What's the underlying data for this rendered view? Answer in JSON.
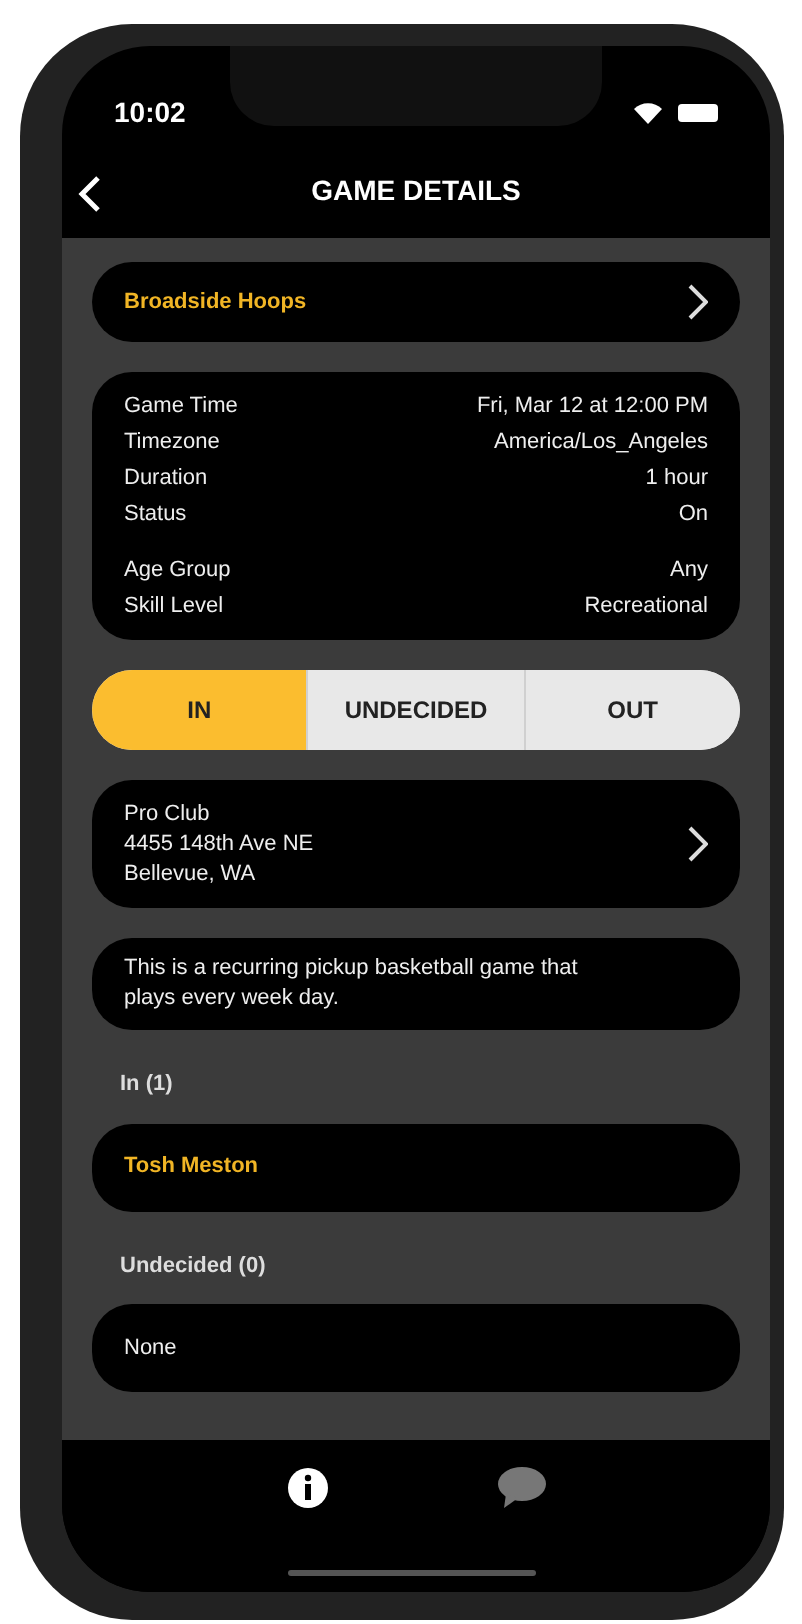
{
  "status_bar": {
    "time": "10:02"
  },
  "nav": {
    "title": "GAME DETAILS"
  },
  "group": {
    "name": "Broadside Hoops"
  },
  "detail_groups": [
    [
      {
        "label": "Game Time",
        "value": "Fri, Mar 12 at 12:00 PM"
      },
      {
        "label": "Timezone",
        "value": "America/Los_Angeles"
      },
      {
        "label": "Duration",
        "value": "1 hour"
      },
      {
        "label": "Status",
        "value": "On"
      }
    ],
    [
      {
        "label": "Age Group",
        "value": "Any"
      },
      {
        "label": "Skill Level",
        "value": "Recreational"
      }
    ]
  ],
  "rsvp_tabs": [
    {
      "label": "IN",
      "selected": true
    },
    {
      "label": "UNDECIDED",
      "selected": false
    },
    {
      "label": "OUT",
      "selected": false
    }
  ],
  "location": {
    "lines": [
      "Pro Club",
      "4455 148th Ave NE",
      "Bellevue, WA"
    ]
  },
  "description": "This is a recurring pickup basketball game that plays every week day.",
  "sections": [
    {
      "heading": "In (1)",
      "items": [
        {
          "kind": "player",
          "text": "Tosh Meston"
        }
      ]
    },
    {
      "heading": "Undecided (0)",
      "items": [
        {
          "kind": "empty",
          "text": "None"
        }
      ]
    }
  ],
  "tab_bar": [
    {
      "kind": "info",
      "selected": true
    },
    {
      "kind": "chat",
      "selected": false
    }
  ]
}
